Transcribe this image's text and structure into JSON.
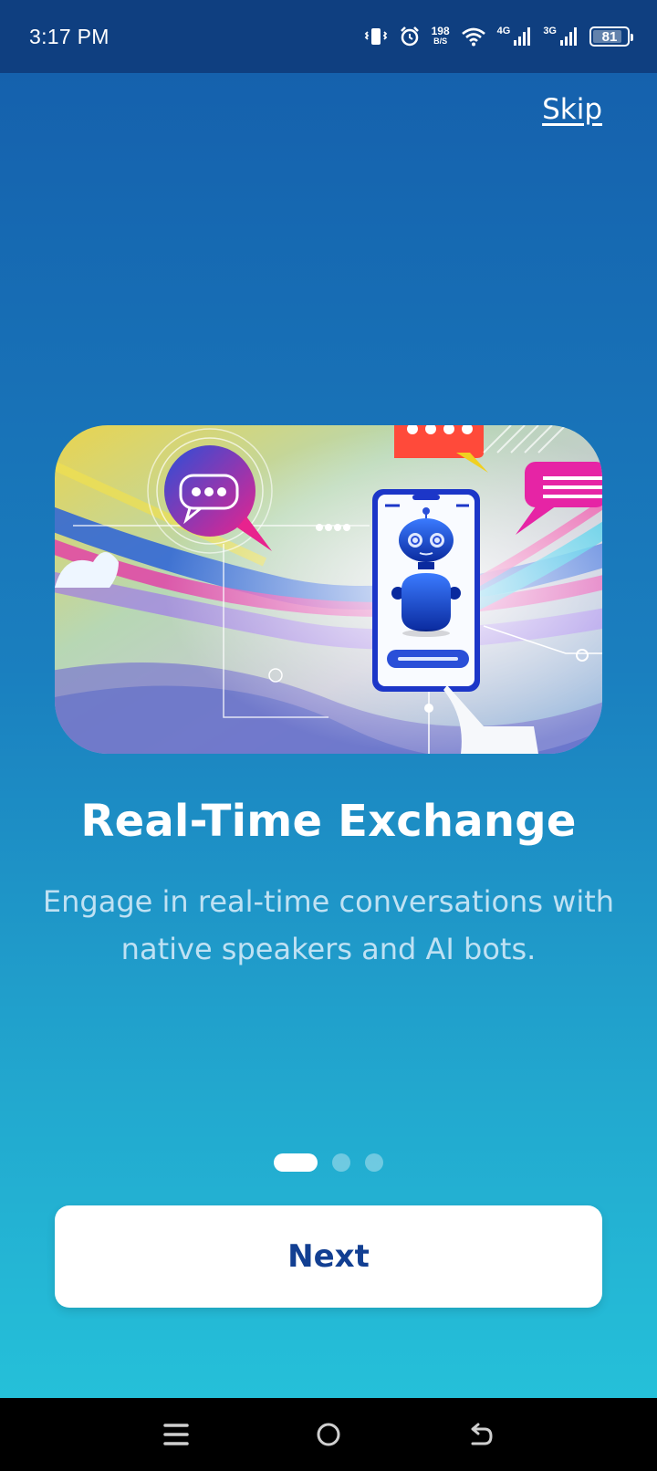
{
  "status_bar": {
    "time": "3:17 PM",
    "net_speed_value": "198",
    "net_speed_unit": "B/S",
    "signal_1_label": "4G",
    "signal_2_label": "3G",
    "battery": "81",
    "icons": [
      "vibrate-icon",
      "alarm-icon",
      "wifi-icon",
      "signal-icon",
      "signal-icon",
      "battery-icon"
    ]
  },
  "onboarding": {
    "skip_label": "Skip",
    "title": "Real-Time Exchange",
    "subtitle": "Engage in real-time conversations with native speakers and AI bots.",
    "next_label": "Next",
    "page_index": 0,
    "page_count": 3
  },
  "nav_bar": {
    "icons": [
      "menu-icon",
      "home-icon",
      "back-icon"
    ]
  },
  "colors": {
    "status_bg": "#0f3f80",
    "gradient_top": "#1561ad",
    "gradient_bottom": "#25c0d9",
    "button_text": "#123f92",
    "subtitle_text": "#bfe1f3"
  }
}
